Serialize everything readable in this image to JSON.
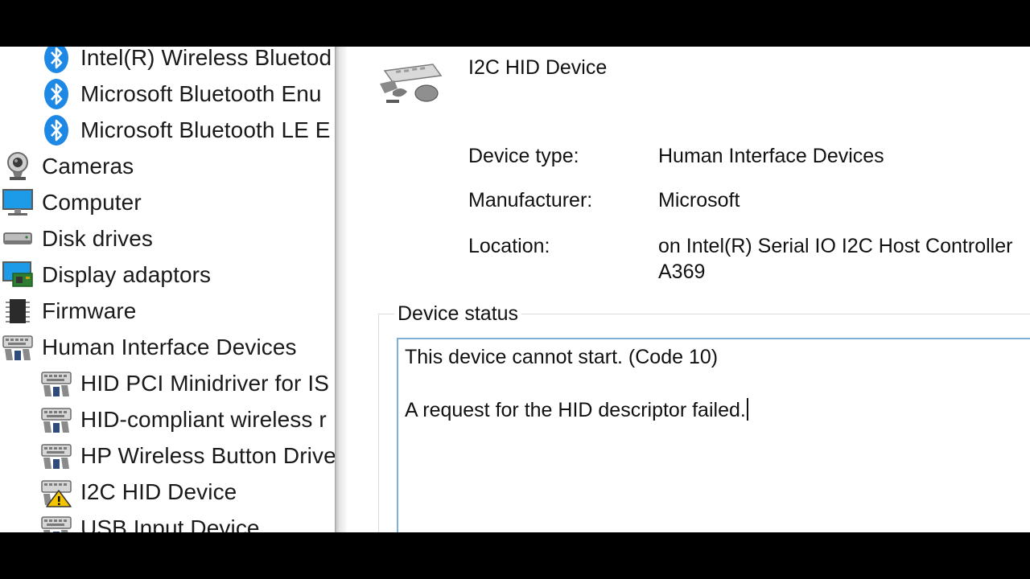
{
  "device_tree": {
    "items": [
      {
        "label": "Intel(R) Wireless Bluetod",
        "icon": "bluetooth-icon",
        "level": 2
      },
      {
        "label": "Microsoft Bluetooth Enu",
        "icon": "bluetooth-icon",
        "level": 2
      },
      {
        "label": "Microsoft Bluetooth LE E",
        "icon": "bluetooth-icon",
        "level": 2
      },
      {
        "label": "Cameras",
        "icon": "camera-icon",
        "level": 1
      },
      {
        "label": "Computer",
        "icon": "monitor-icon",
        "level": 1
      },
      {
        "label": "Disk drives",
        "icon": "disk-drive-icon",
        "level": 1
      },
      {
        "label": "Display adaptors",
        "icon": "display-adapter-icon",
        "level": 1
      },
      {
        "label": "Firmware",
        "icon": "firmware-chip-icon",
        "level": 1
      },
      {
        "label": "Human Interface Devices",
        "icon": "hid-keyboard-icon",
        "level": 1
      },
      {
        "label": "HID PCI Minidriver for IS",
        "icon": "hid-keyboard-icon",
        "level": 2
      },
      {
        "label": "HID-compliant wireless r",
        "icon": "hid-keyboard-icon",
        "level": 2
      },
      {
        "label": "HP Wireless Button Drive",
        "icon": "hid-keyboard-icon",
        "level": 2
      },
      {
        "label": "I2C HID Device",
        "icon": "hid-warning-icon",
        "level": 2
      },
      {
        "label": "USB Input Device",
        "icon": "hid-keyboard-icon",
        "level": 2
      }
    ]
  },
  "properties": {
    "device_name": "I2C HID Device",
    "device_type_label": "Device type:",
    "device_type_value": "Human Interface Devices",
    "manufacturer_label": "Manufacturer:",
    "manufacturer_value": "Microsoft",
    "location_label": "Location:",
    "location_value_line1": "on Intel(R) Serial IO I2C Host Controller",
    "location_value_line2": "A369"
  },
  "device_status": {
    "group_label": "Device status",
    "line1": "This device cannot start. (Code 10)",
    "line2": "A request for the HID descriptor failed."
  },
  "colors": {
    "bluetooth": "#1e88e5",
    "warning": "#f5c400",
    "status_box_border": "#7fb0d8"
  }
}
